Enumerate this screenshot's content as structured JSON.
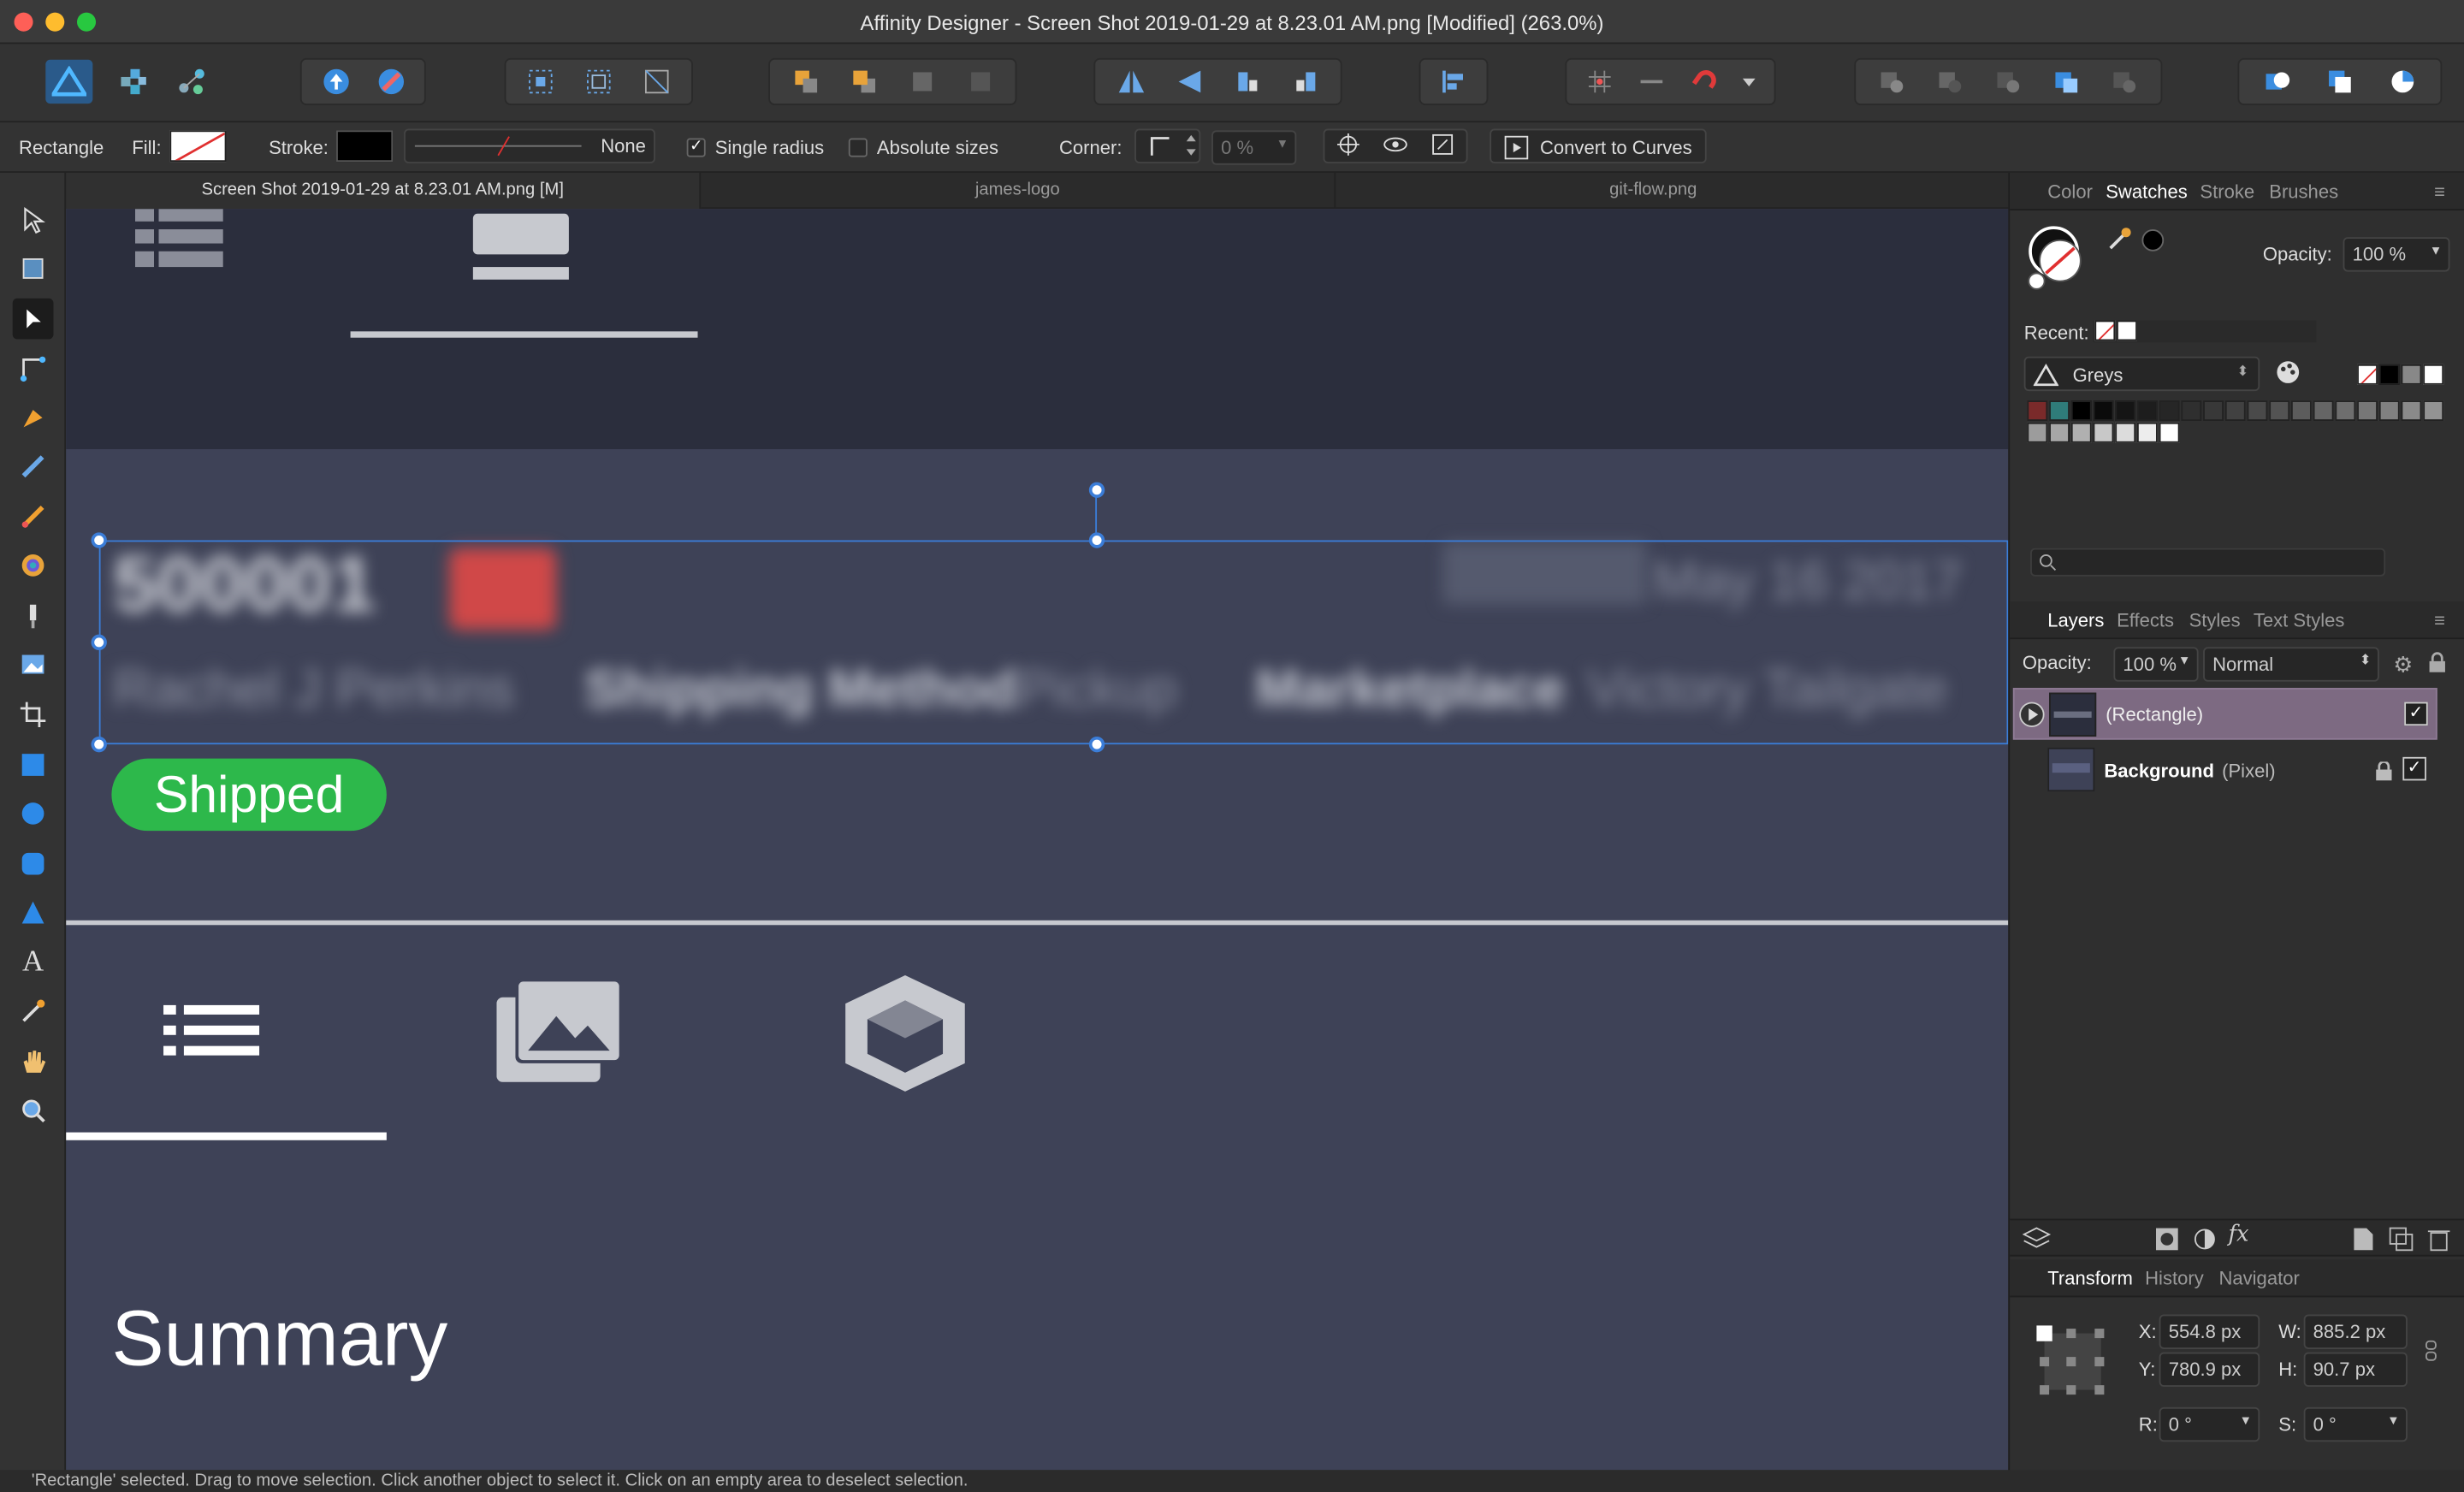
{
  "window": {
    "title": "Affinity Designer - Screen Shot 2019-01-29 at 8.23.01 AM.png [Modified] (263.0%)"
  },
  "toolbar": {
    "groups": [
      {
        "name": "personas",
        "icons": [
          "designer-persona-icon",
          "pixel-persona-icon",
          "export-persona-icon"
        ]
      },
      {
        "name": "share",
        "icons": [
          "upload-icon",
          "brush-icon"
        ]
      },
      {
        "name": "selection",
        "icons": [
          "grid-select-icon",
          "box-select-icon",
          "transform-select-icon"
        ]
      },
      {
        "name": "arrange",
        "icons": [
          "arrange-forward-icon",
          "arrange-back-icon",
          "arrange-front-icon",
          "arrange-bottom-icon"
        ]
      },
      {
        "name": "flip",
        "icons": [
          "flip-horizontal-icon",
          "flip-vertical-icon",
          "rotate-left-icon",
          "rotate-right-icon"
        ]
      },
      {
        "name": "align",
        "icons": [
          "align-left-icon"
        ]
      },
      {
        "name": "snapping",
        "icons": [
          "snap-grid-icon",
          "snap-guide-icon",
          "magnet-icon",
          "dropdown-icon"
        ]
      },
      {
        "name": "boolean",
        "icons": [
          "add-icon",
          "subtract-icon",
          "intersect-icon",
          "divide-icon",
          "combine-icon"
        ]
      },
      {
        "name": "geometry",
        "icons": [
          "insert-icon",
          "ungroup-icon",
          "pie-icon"
        ]
      }
    ]
  },
  "context": {
    "tool_name": "Rectangle",
    "fill_label": "Fill:",
    "stroke_label": "Stroke:",
    "stroke_style": "None",
    "single_radius": {
      "label": "Single radius",
      "checked": true
    },
    "absolute_sizes": {
      "label": "Absolute sizes",
      "checked": false
    },
    "corner_label": "Corner:",
    "corner_value": "0 %",
    "convert_label": "Convert to Curves"
  },
  "tools": [
    "move-tool-icon",
    "artboard-tool-icon",
    "node-tool-icon",
    "corner-tool-icon",
    "pen-tool-icon",
    "pencil-tool-icon",
    "vector-brush-icon",
    "fill-tool-icon",
    "transparency-tool-icon",
    "place-image-icon",
    "crop-tool-icon",
    "rectangle-tool-icon",
    "ellipse-tool-icon",
    "rounded-rect-icon",
    "triangle-tool-icon",
    "text-tool-icon",
    "color-picker-icon",
    "hand-tool-icon",
    "zoom-tool-icon"
  ],
  "doc_tabs": [
    "Screen Shot 2019-01-29 at 8.23.01 AM.png [M]",
    "james-logo",
    "git-flow.png"
  ],
  "canvas": {
    "order_number": "500001",
    "ship_date": "May 16 2017",
    "customer": "Rachel J Perkins",
    "shipping_method_label": "Shipping Method",
    "shipping_method": "Pickup",
    "marketplace_label": "Marketplace",
    "marketplace": "Victory Tailgate",
    "status_badge": "Shipped",
    "summary_heading": "Summary",
    "colors": {
      "badge": "#2db84b",
      "bg_top": "#2b2e3d",
      "bg_main": "#3e4257"
    }
  },
  "swatch_panel": {
    "tabs": [
      "Color",
      "Swatches",
      "Stroke",
      "Brushes"
    ],
    "active": "Swatches",
    "opacity_label": "Opacity:",
    "opacity_value": "100 %",
    "recent_label": "Recent:",
    "palette": "Greys",
    "colors": [
      "#7a2a2a",
      "#2f7c7a",
      "#000000",
      "#0b0b0b",
      "#151515",
      "#1d1d1d",
      "#262626",
      "#2f2f2f",
      "#383838",
      "#414141",
      "#4a4a4a",
      "#535353",
      "#5c5c5c",
      "#656565",
      "#6e6e6e",
      "#777777",
      "#808080",
      "#8a8a8a",
      "#939393",
      "#9c9c9c",
      "#a6a6a6",
      "#b0b0b0",
      "#c8c8c8",
      "#dcdcdc",
      "#ededed",
      "#ffffff"
    ]
  },
  "layers_panel": {
    "tabs": [
      "Layers",
      "Effects",
      "Styles",
      "Text Styles"
    ],
    "active": "Layers",
    "opacity_label": "Opacity:",
    "opacity_value": "100 %",
    "blend_mode": "Normal",
    "layers": [
      {
        "name": "(Rectangle)",
        "type": "",
        "selected": true
      },
      {
        "name": "Background",
        "type": "(Pixel)",
        "selected": false
      }
    ]
  },
  "transform_panel": {
    "tabs": [
      "Transform",
      "History",
      "Navigator"
    ],
    "active": "Transform",
    "x_label": "X:",
    "x": "554.8 px",
    "y_label": "Y:",
    "y": "780.9 px",
    "w_label": "W:",
    "w": "885.2 px",
    "h_label": "H:",
    "h": "90.7 px",
    "r_label": "R:",
    "r": "0 °",
    "s_label": "S:",
    "s": "0 °"
  },
  "status": {
    "text": "'Rectangle' selected. Drag to move selection. Click another object to select it. Click on an empty area to deselect selection."
  }
}
